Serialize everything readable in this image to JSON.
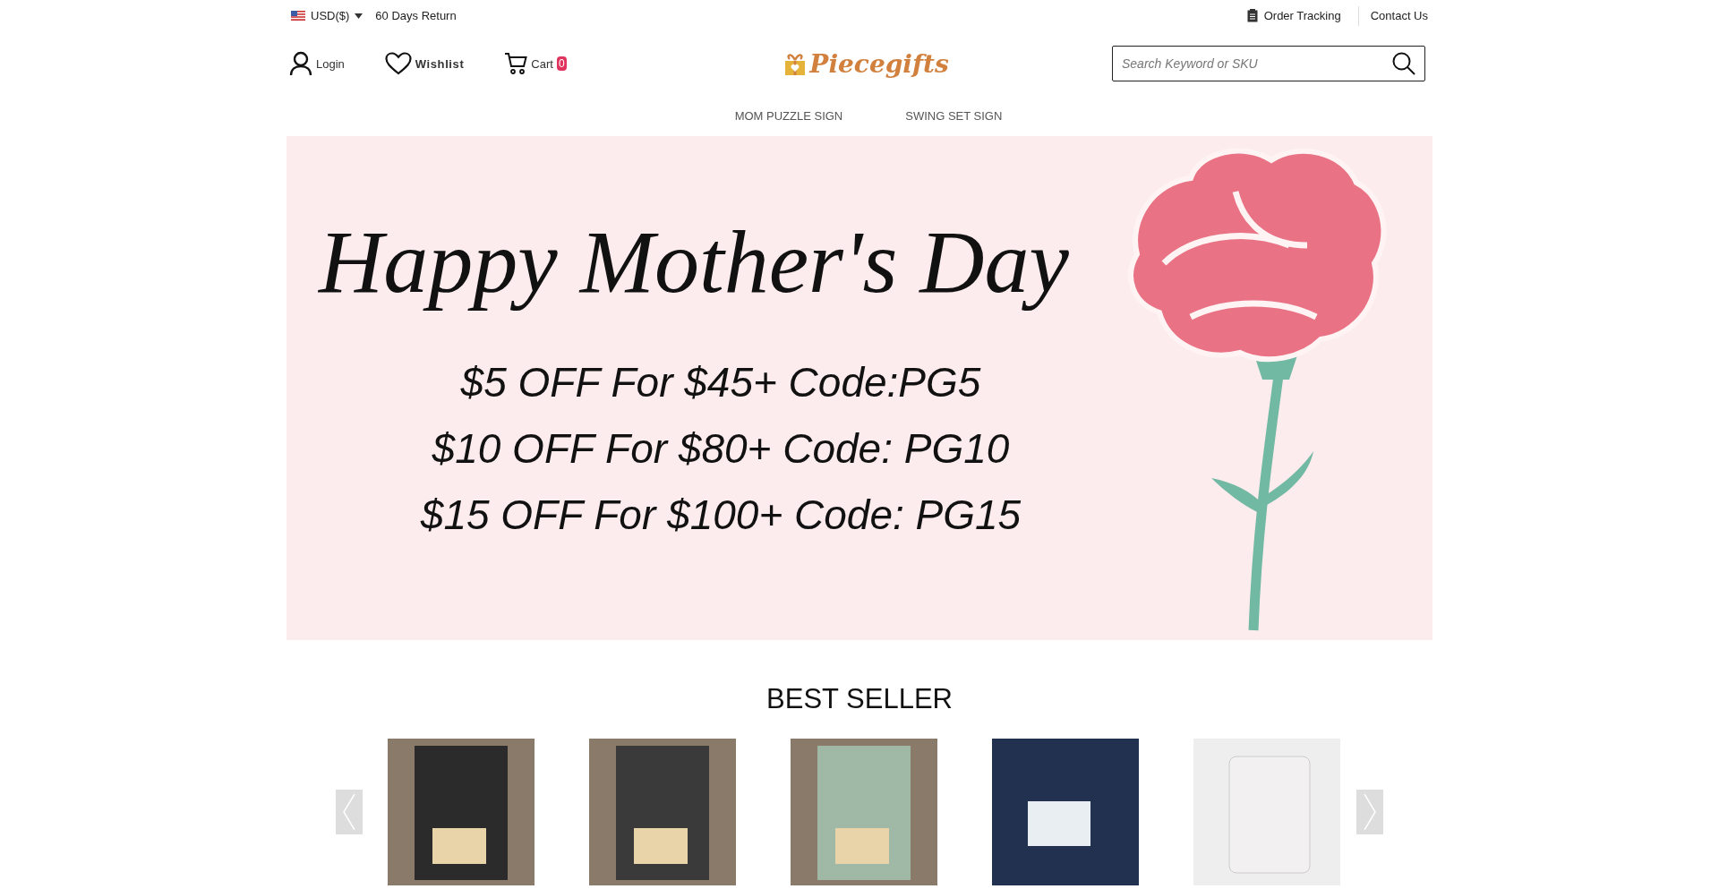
{
  "top_bar": {
    "currency": "USD($)",
    "returns": "60 Days Return",
    "links": [
      "Order Tracking",
      "Contact Us"
    ]
  },
  "header": {
    "login": "Login",
    "wishlist": "Wishlist",
    "cart": "Cart",
    "cart_count": "0",
    "logo": "Piecegifts",
    "search": {
      "placeholder": "Search Keyword or SKU"
    }
  },
  "nav": [
    "MOM PUZZLE SIGN",
    "SWING SET SIGN"
  ],
  "banner": {
    "title": "Happy Mother's Day",
    "offers": [
      "$5 OFF For $45+ Code:PG5",
      "$10 OFF For $80+ Code: PG10",
      "$15 OFF For $100+ Code: PG15"
    ]
  },
  "best_seller": {
    "title": "BEST SELLER",
    "products": [
      {
        "kind": "frame",
        "color": "#2b2b2b"
      },
      {
        "kind": "frame",
        "color": "#3a3a3a"
      },
      {
        "kind": "frame",
        "color": "#9fb9a6"
      },
      {
        "kind": "puzzle",
        "color": "#233150"
      },
      {
        "kind": "mug",
        "color": "#f2f0f0"
      }
    ]
  }
}
